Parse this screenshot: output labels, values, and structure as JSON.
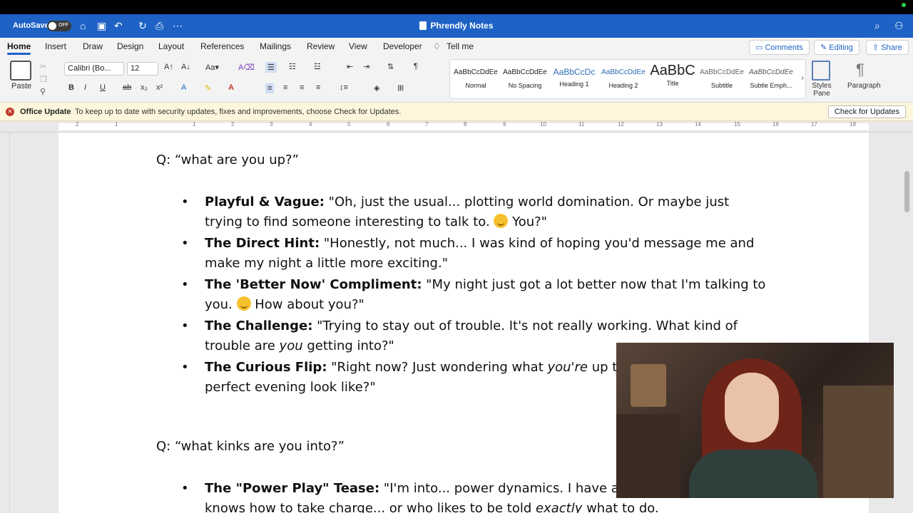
{
  "titlebar": {
    "autosave_label": "AutoSave",
    "autosave_state": "OFF",
    "document_title": "Phrendly Notes"
  },
  "tabs": [
    "Home",
    "Insert",
    "Draw",
    "Design",
    "Layout",
    "References",
    "Mailings",
    "Review",
    "View",
    "Developer",
    "Tell me"
  ],
  "tab_actions": {
    "comments": "Comments",
    "editing": "Editing",
    "share": "Share"
  },
  "ribbon": {
    "paste_label": "Paste",
    "font_name": "Calibri (Bo...",
    "font_size": "12",
    "styles": [
      {
        "preview": "AaBbCcDdEe",
        "name": "Normal"
      },
      {
        "preview": "AaBbCcDdEe",
        "name": "No Spacing"
      },
      {
        "preview": "AaBbCcDc",
        "name": "Heading 1"
      },
      {
        "preview": "AaBbCcDdEe",
        "name": "Heading 2"
      },
      {
        "preview": "AaBbC",
        "name": "Title"
      },
      {
        "preview": "AaBbCcDdEe",
        "name": "Subtitle"
      },
      {
        "preview": "AaBbCcDdEe",
        "name": "Subtle Emph..."
      }
    ],
    "styles_pane_label": "Styles Pane",
    "paragraph_label": "Paragraph"
  },
  "notification": {
    "title": "Office Update",
    "message": "To keep up to date with security updates, fixes and improvements, choose Check for Updates.",
    "button": "Check for Updates"
  },
  "ruler_numbers": [
    "2",
    "1",
    "1",
    "2",
    "3",
    "4",
    "5",
    "6",
    "7",
    "8",
    "9",
    "10",
    "11",
    "12",
    "13",
    "14",
    "15",
    "16",
    "17",
    "18"
  ],
  "document": {
    "q1": "Q: “what are you up?”",
    "items1": [
      {
        "bold": "Playful & Vague:",
        "text1": " \"Oh, just the usual... plotting world domination. Or maybe just trying to find someone interesting to talk to. ",
        "text2": " You?\""
      },
      {
        "bold": "The Direct Hint:",
        "text1": " \"Honestly, not much... I was kind of hoping you'd message me and make my night a little more exciting.\""
      },
      {
        "bold": "The 'Better Now' Compliment:",
        "text1": " \"My night just got a lot better now that I'm talking to you. ",
        "text2": " How about you?\""
      },
      {
        "bold": "The Challenge:",
        "text1": " \"Trying to stay out of trouble. It's not really working. What kind of trouble are ",
        "italic": "you",
        "text2": " getting into?\""
      },
      {
        "bold": "The Curious Flip:",
        "text1": " \"Right now? Just wondering what ",
        "italic": "you're",
        "text2": " up to... what does a perfect evening look like?\""
      }
    ],
    "q2": "Q: “what kinks are you into?”",
    "items2": [
      {
        "bold": "The \"Power Play\" Tease:",
        "text1": " \"I'm into... power dynamics. I have a thing for a man who knows how to take charge... or who likes to be told ",
        "italic": "exactly",
        "text2": " what to do."
      }
    ]
  }
}
